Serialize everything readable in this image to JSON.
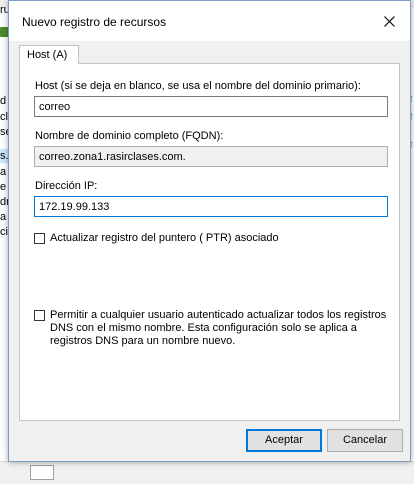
{
  "background": {
    "left_fragments": [
      "ruc",
      "d",
      "cl",
      "ses",
      "s.c",
      "a in",
      "e ir",
      "dr.",
      "a in",
      "cio"
    ],
    "right_fragments": [
      "⇧",
      "⇧",
      "⇧"
    ]
  },
  "dialog": {
    "title": "Nuevo registro de recursos",
    "tab_label": "Host (A)",
    "host": {
      "label": "Host (si se deja en blanco, se usa el nombre del dominio primario):",
      "value": "correo"
    },
    "fqdn": {
      "label": "Nombre de dominio completo (FQDN):",
      "value": "correo.zona1.rasirclases.com."
    },
    "ip": {
      "label": "Dirección IP:",
      "value": "172.19.99.133"
    },
    "ptr_checkbox": {
      "label": "Actualizar registro del puntero ( PTR) asociado",
      "checked": false
    },
    "auth_checkbox": {
      "label": "Permitir a cualquier usuario autenticado actualizar todos los registros DNS con el mismo nombre. Esta configuración solo se aplica a registros DNS para un nombre nuevo.",
      "checked": false
    },
    "buttons": {
      "ok": "Aceptar",
      "cancel": "Cancelar"
    },
    "colors": {
      "accent": "#0078d7",
      "panel": "#f0f0f0"
    }
  }
}
